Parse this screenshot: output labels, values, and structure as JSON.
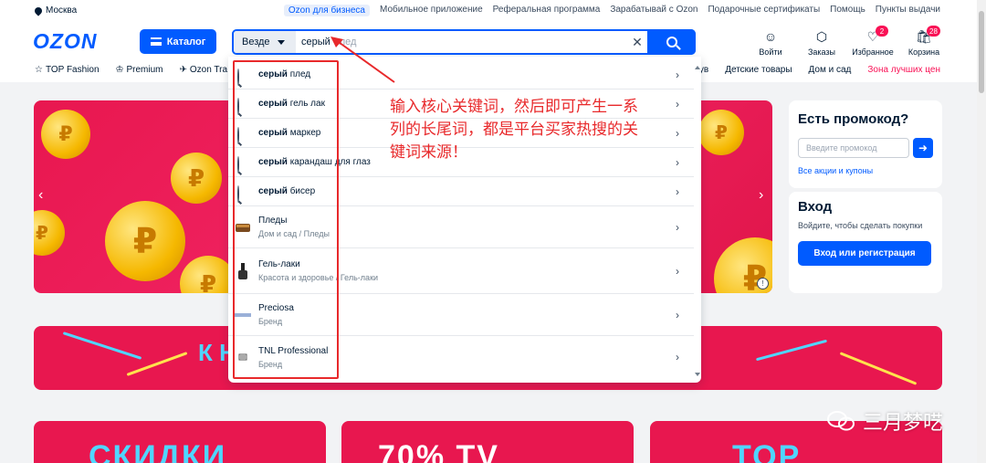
{
  "topbar": {
    "city": "Москва",
    "links": [
      "Ozon для бизнеса",
      "Мобильное приложение",
      "Реферальная программа",
      "Зарабатывай с Ozon",
      "Подарочные сертификаты",
      "Помощь",
      "Пункты выдачи"
    ]
  },
  "header": {
    "logo": "OZON",
    "catalog_label": "Каталог",
    "search_scope": "Везде",
    "search_typed": "серый",
    "search_hint": "плед",
    "clear_glyph": "✕",
    "icons": [
      {
        "name": "login",
        "label": "Войти",
        "glyph": "☺",
        "badge": ""
      },
      {
        "name": "orders",
        "label": "Заказы",
        "glyph": "⬡",
        "badge": ""
      },
      {
        "name": "favorites",
        "label": "Избранное",
        "glyph": "♡",
        "badge": "2"
      },
      {
        "name": "cart",
        "label": "Корзина",
        "glyph": "🛍",
        "badge": "28"
      }
    ]
  },
  "nav": {
    "left": [
      "TOP Fashion",
      "Premium",
      "Ozon Tra"
    ],
    "right": [
      "ув",
      "Детские товары",
      "Дом и сад",
      "Зона лучших цен"
    ]
  },
  "suggestions": {
    "queries": [
      {
        "bold": "серый",
        "rest": "плед"
      },
      {
        "bold": "серый",
        "rest": "гель лак"
      },
      {
        "bold": "серый",
        "rest": "маркер"
      },
      {
        "bold": "серый",
        "rest": "карандаш для глаз"
      },
      {
        "bold": "серый",
        "rest": "бисер"
      }
    ],
    "categories": [
      {
        "title": "Пледы",
        "path": "Дом и сад  /  Пледы"
      },
      {
        "title": "Гель-лаки",
        "path": "Красота и здоровье  /  Гель-лаки"
      }
    ],
    "brands": [
      {
        "title": "Preciosa",
        "sub": "Бренд"
      },
      {
        "title": "TNL Professional",
        "sub": "Бренд"
      }
    ]
  },
  "promo": {
    "title": "Есть промокод?",
    "placeholder": "Введите промокод",
    "link": "Все акции и купоны"
  },
  "login": {
    "title": "Вход",
    "text": "Войдите, чтобы сделать покупки",
    "button": "Вход или регистрация"
  },
  "banners": {
    "wide_text": "К Н",
    "card1": "СКИДКИ",
    "card2": "70% TV",
    "card3": "TOP"
  },
  "annotation": {
    "note": "输入核心关键词，然后即可产生一系列的长尾词，都是平台买家热搜的关键词来源！",
    "watermark": "三月梦呓"
  },
  "colors": {
    "brand": "#005bff",
    "accent": "#f91155",
    "annotation": "#e8292b"
  }
}
